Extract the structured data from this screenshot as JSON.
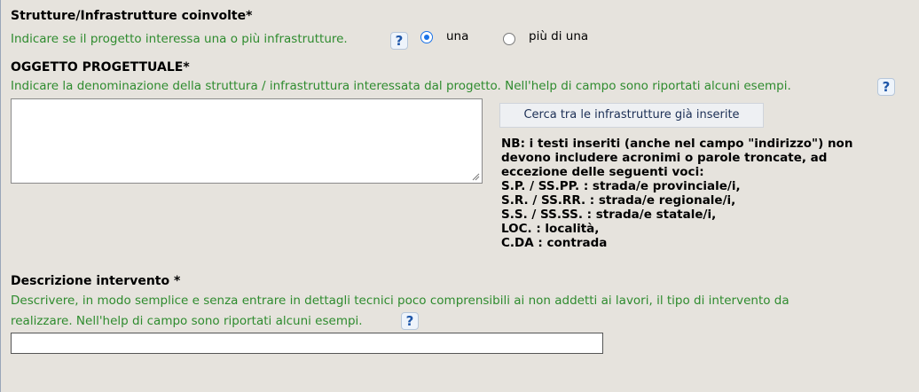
{
  "strutture": {
    "title": "Strutture/Infrastrutture coinvolte*",
    "hint": "Indicare se il progetto interessa una o più infrastrutture.",
    "help_label": "?",
    "options": [
      {
        "label": "una",
        "checked": true
      },
      {
        "label": "più di una",
        "checked": false
      }
    ]
  },
  "oggetto": {
    "title": "OGGETTO PROGETTUALE*",
    "hint": "Indicare la denominazione della struttura / infrastruttura interessata dal progetto. Nell'help di campo sono riportati alcuni esempi.",
    "help_label": "?",
    "value": "",
    "search_button": "Cerca tra le infrastrutture già inserite",
    "note_lines": [
      "NB: i testi inseriti (anche nel campo \"indirizzo\") non",
      "devono includere acronimi o parole troncate, ad",
      "eccezione delle seguenti voci:",
      "S.P. / SS.PP. : strada/e provinciale/i,",
      "S.R. / SS.RR. : strada/e regionale/i,",
      "S.S. / SS.SS. : strada/e statale/i,",
      "LOC. : località,",
      "C.DA : contrada"
    ]
  },
  "descrizione": {
    "title": "Descrizione intervento *",
    "hint_line1": "Descrivere, in modo semplice e senza entrare in dettagli tecnici poco comprensibili ai non addetti ai lavori, il tipo di intervento da",
    "hint_line2": "realizzare. Nell'help di campo sono riportati alcuni esempi.",
    "help_label": "?",
    "value": ""
  },
  "colors": {
    "background": "#e6e3dd",
    "hint_text": "#2e8b2e",
    "help_icon": "#1e56a8",
    "radio_accent": "#1a73e8"
  },
  "icons": {
    "help": "question-mark-icon",
    "resize": "resize-grip-icon"
  }
}
